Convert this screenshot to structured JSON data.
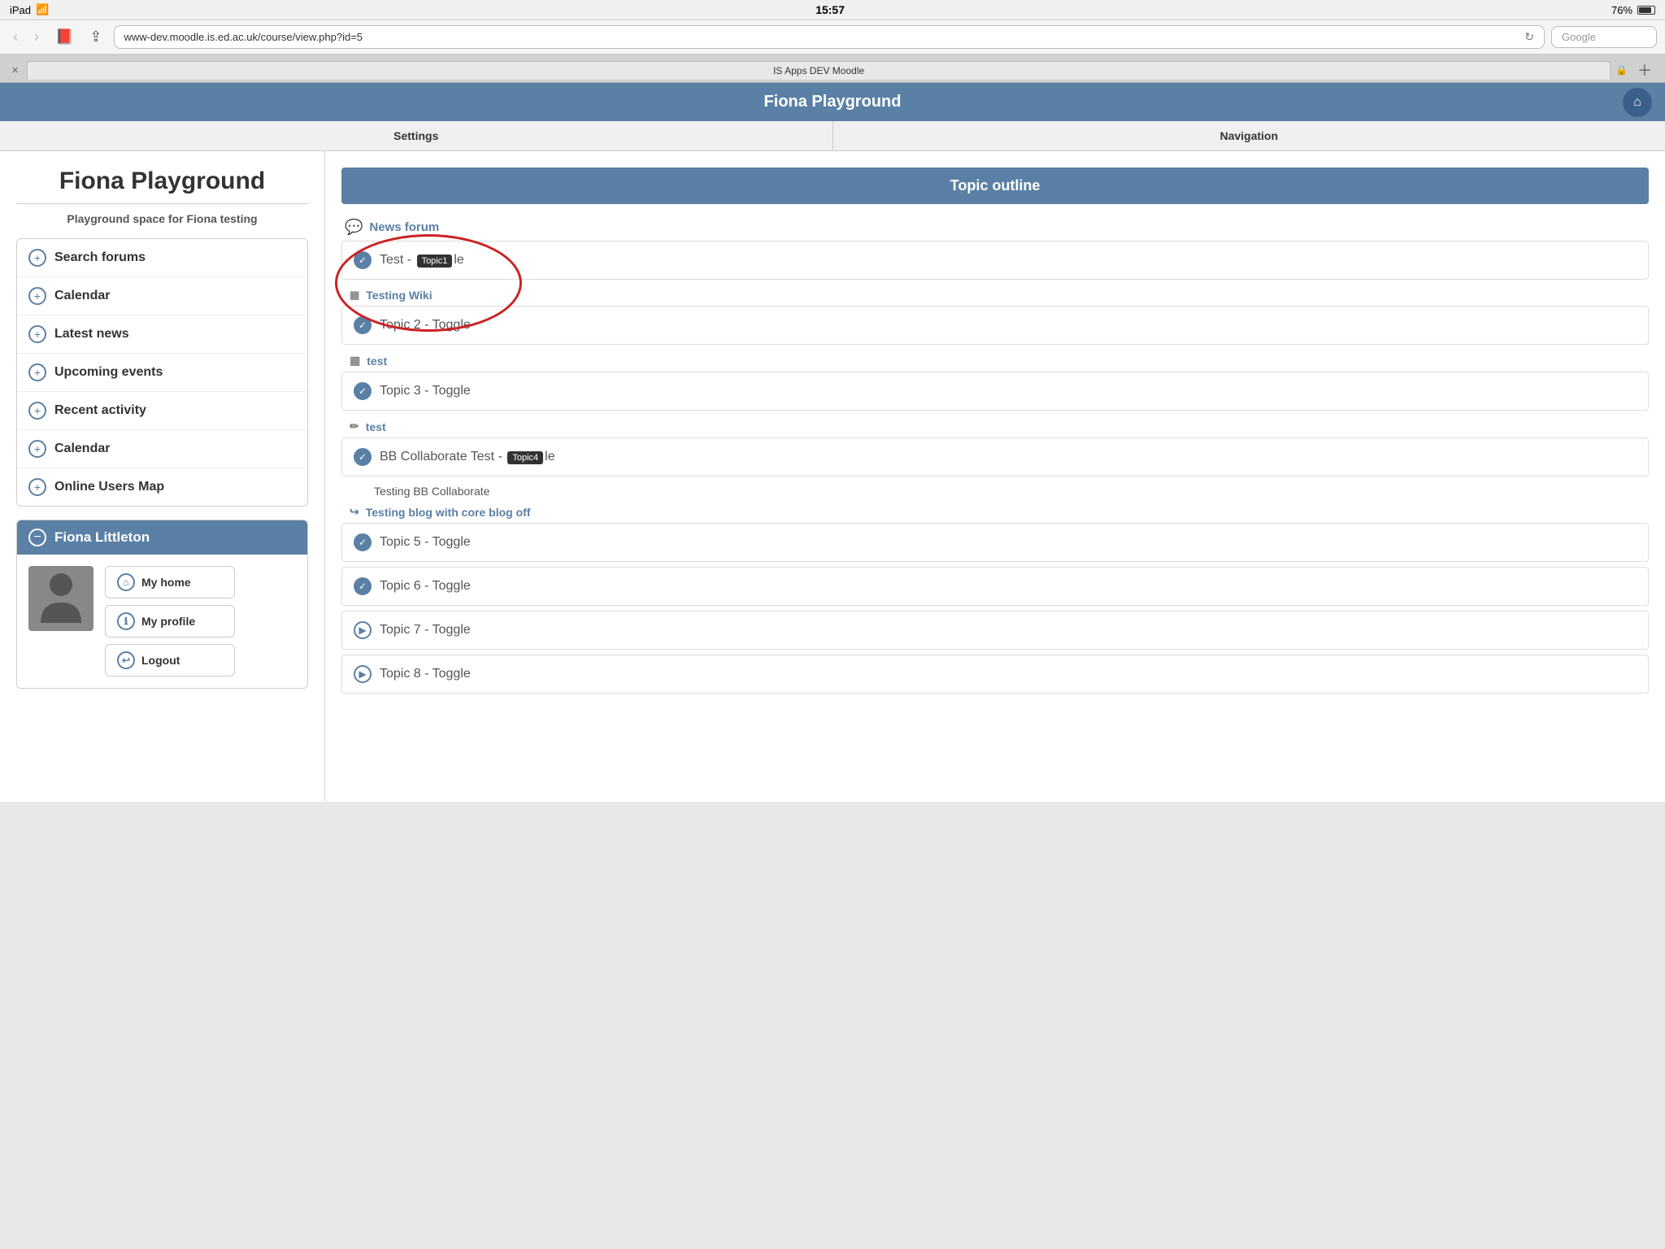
{
  "statusBar": {
    "device": "iPad",
    "wifi": "wifi",
    "time": "15:57",
    "battery": "76%"
  },
  "browser": {
    "url": "www-dev.moodle.is.ed.ac.uk/course/view.php?id=5",
    "search_placeholder": "Google",
    "tab_label": "IS Apps DEV Moodle"
  },
  "header": {
    "title": "Fiona Playground",
    "home_icon": "⌂"
  },
  "settingsNav": {
    "settings_label": "Settings",
    "navigation_label": "Navigation"
  },
  "leftPanel": {
    "course_title": "Fiona Playground",
    "course_description": "Playground space for Fiona testing",
    "sidebarItems": [
      {
        "label": "Search forums"
      },
      {
        "label": "Calendar"
      },
      {
        "label": "Latest news"
      },
      {
        "label": "Upcoming events"
      },
      {
        "label": "Recent activity"
      },
      {
        "label": "Calendar"
      },
      {
        "label": "Online Users Map"
      }
    ],
    "user": {
      "name": "Fiona Littleton",
      "links": [
        {
          "label": "My home",
          "icon": "⌂"
        },
        {
          "label": "My profile",
          "icon": "ℹ"
        },
        {
          "label": "Logout",
          "icon": "↩"
        }
      ]
    }
  },
  "rightPanel": {
    "topic_outline_label": "Topic outline",
    "news_forum_label": "News forum",
    "topics": [
      {
        "type": "toggle",
        "label": "Test -",
        "badge": "Topic1",
        "badge_suffix": "le",
        "has_circle": true
      },
      {
        "type": "wiki_link",
        "label": "Testing Wiki",
        "has_circle": true
      },
      {
        "type": "toggle",
        "label": "Topic 2 - Toggle"
      },
      {
        "type": "sub_link",
        "label": "test",
        "icon": "monitor"
      },
      {
        "type": "toggle",
        "label": "Topic 3 - Toggle"
      },
      {
        "type": "sub_link",
        "label": "test",
        "icon": "pencil"
      },
      {
        "type": "toggle_bb",
        "label": "BB Collaborate Test -",
        "badge": "Topic4",
        "badge_suffix": "le"
      },
      {
        "type": "description",
        "text": "Testing BB Collaborate"
      },
      {
        "type": "blog_link",
        "label": "Testing blog with core blog off"
      },
      {
        "type": "toggle",
        "label": "Topic 5 - Toggle"
      },
      {
        "type": "toggle",
        "label": "Topic 6 - Toggle"
      },
      {
        "type": "toggle_arrow",
        "label": "Topic 7 - Toggle"
      },
      {
        "type": "toggle_arrow",
        "label": "Topic 8 - Toggle"
      }
    ]
  }
}
